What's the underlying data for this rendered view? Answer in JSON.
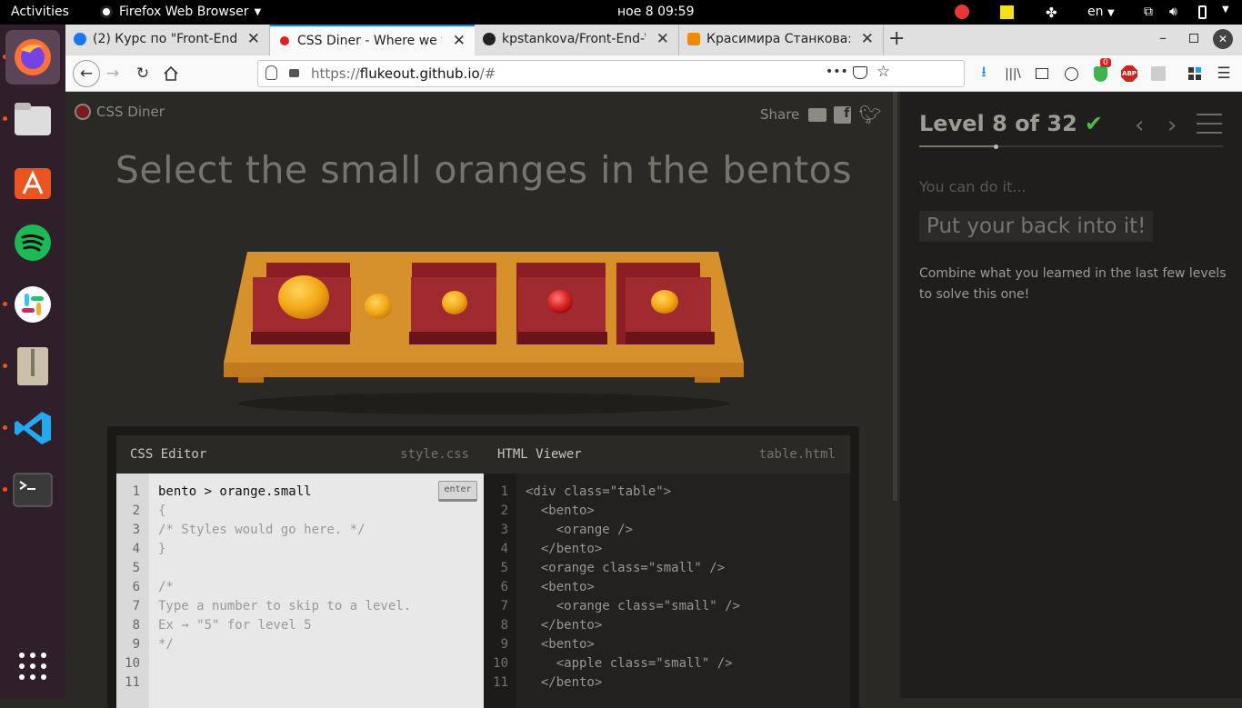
{
  "system": {
    "activities": "Activities",
    "app_name": "Firefox Web Browser",
    "clock": "ное 8  09:59",
    "language": "en"
  },
  "dock": {
    "items": [
      "firefox-icon",
      "files-icon",
      "software-icon",
      "spotify-icon",
      "slack-icon",
      "archive-icon",
      "vscode-icon",
      "terminal-icon"
    ]
  },
  "browser": {
    "tabs": [
      {
        "label": "(2) Курс по \"Front-End W",
        "favicon": "facebook-icon"
      },
      {
        "label": "CSS Diner - Where we fe",
        "favicon": "css-diner-icon"
      },
      {
        "label": "kpstankova/Front-End-W",
        "favicon": "github-icon"
      },
      {
        "label": "Красимира Станкова: П",
        "favicon": "medium-icon"
      }
    ],
    "url_prefix": "https://",
    "url_host": "flukeout.github.io",
    "url_suffix": "/#",
    "url_dots": "•••",
    "badge_count": "0",
    "abp_label": "ABP"
  },
  "game": {
    "logo": "CSS Diner",
    "share": "Share",
    "instruction": "Select the small oranges in the bentos",
    "css_editor": {
      "title": "CSS Editor",
      "filename": "style.css",
      "enter_label": "enter",
      "line_numbers": [
        "1",
        "2",
        "3",
        "4",
        "5",
        "6",
        "7",
        "8",
        "9",
        "10",
        "11"
      ],
      "lines": [
        "bento > orange.small",
        "{",
        "/* Styles would go here. */",
        "}",
        "",
        "/*",
        "Type a number to skip to a level.",
        "Ex → \"5\" for level 5",
        "*/",
        "",
        ""
      ]
    },
    "html_viewer": {
      "title": "HTML Viewer",
      "filename": "table.html",
      "line_numbers": [
        "1",
        "2",
        "3",
        "4",
        "5",
        "6",
        "7",
        "8",
        "9",
        "10",
        "11"
      ],
      "lines": [
        "<div class=\"table\">",
        "  <bento>",
        "    <orange />",
        "  </bento>",
        "  <orange class=\"small\" />",
        "  <bento>",
        "    <orange class=\"small\" />",
        "  </bento>",
        "  <bento>",
        "    <apple class=\"small\" />",
        "  </bento>"
      ]
    }
  },
  "sidebar": {
    "level_title": "Level 8 of 32",
    "level_progress": 0.25,
    "subtitle": "You can do it...",
    "heading": "Put your back into it!",
    "description": "Combine what you learned in the last few levels to solve this one!"
  },
  "colors": {
    "accent_green": "#4cbb4a",
    "orange": "#f2a818",
    "apple": "#d92020",
    "table": "#d6912d",
    "bento": "#8c1d24"
  }
}
